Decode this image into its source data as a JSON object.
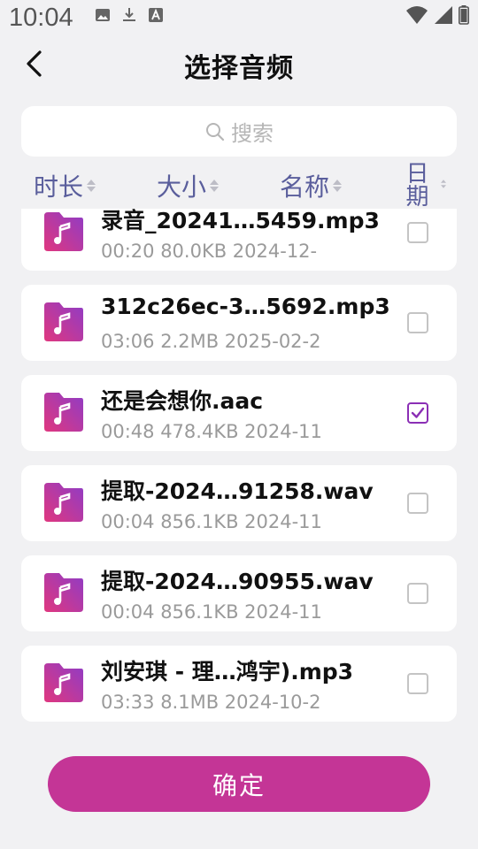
{
  "status_bar": {
    "time": "10:04",
    "left_icons": [
      "image-icon",
      "download-icon",
      "font-a-icon"
    ],
    "right_icons": [
      "wifi-icon",
      "signal-icon",
      "battery-icon"
    ]
  },
  "header": {
    "title": "选择音频",
    "back_icon": "chevron-left-icon"
  },
  "search": {
    "placeholder": "搜索"
  },
  "sort_bar": {
    "items": [
      {
        "label": "时长"
      },
      {
        "label": "大小"
      },
      {
        "label": "名称"
      },
      {
        "label": "日期"
      }
    ]
  },
  "files": [
    {
      "name": "录音_20241…5459.mp3",
      "meta": "00:20  80.0KB  2024-12-",
      "checked": false
    },
    {
      "name": "312c26ec-3…5692.mp3",
      "meta": "03:06  2.2MB  2025-02-2",
      "checked": false
    },
    {
      "name": "还是会想你.aac",
      "meta": "00:48  478.4KB  2024-11",
      "checked": true
    },
    {
      "name": "提取-2024…91258.wav",
      "meta": "00:04  856.1KB  2024-11",
      "checked": false
    },
    {
      "name": "提取-2024…90955.wav",
      "meta": "00:04  856.1KB  2024-11",
      "checked": false
    },
    {
      "name": "刘安琪 - 理…鸿宇).mp3",
      "meta": "03:33  8.1MB  2024-10-2",
      "checked": false
    }
  ],
  "confirm_button": {
    "label": "确定"
  },
  "colors": {
    "accent": "#c43596",
    "sort_text": "#5a5e9c",
    "checkbox_checked": "#8b2fb5",
    "icon_gradient_start": "#e0377f",
    "icon_gradient_end": "#8f3cc6"
  }
}
